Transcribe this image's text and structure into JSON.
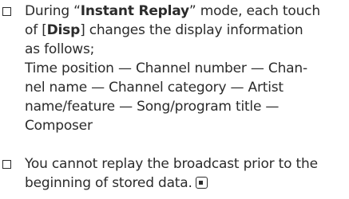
{
  "items": [
    {
      "lines": [
        {
          "pre": "During “",
          "bold": "Instant Replay",
          "post": "” mode, each touch"
        },
        {
          "pre": "of [",
          "bold": "Disp",
          "post": "] changes the display information"
        },
        {
          "text": "as follows;"
        },
        {
          "text": "Time position — Channel number — Chan-"
        },
        {
          "text": "nel name — Channel category — Artist"
        },
        {
          "text": "name/feature — Song/program title —"
        },
        {
          "text": "Composer"
        }
      ]
    },
    {
      "lines": [
        {
          "text": "You cannot replay the broadcast prior to the"
        },
        {
          "text": "beginning of stored data."
        }
      ],
      "end_icon": "end-of-section-icon"
    }
  ]
}
